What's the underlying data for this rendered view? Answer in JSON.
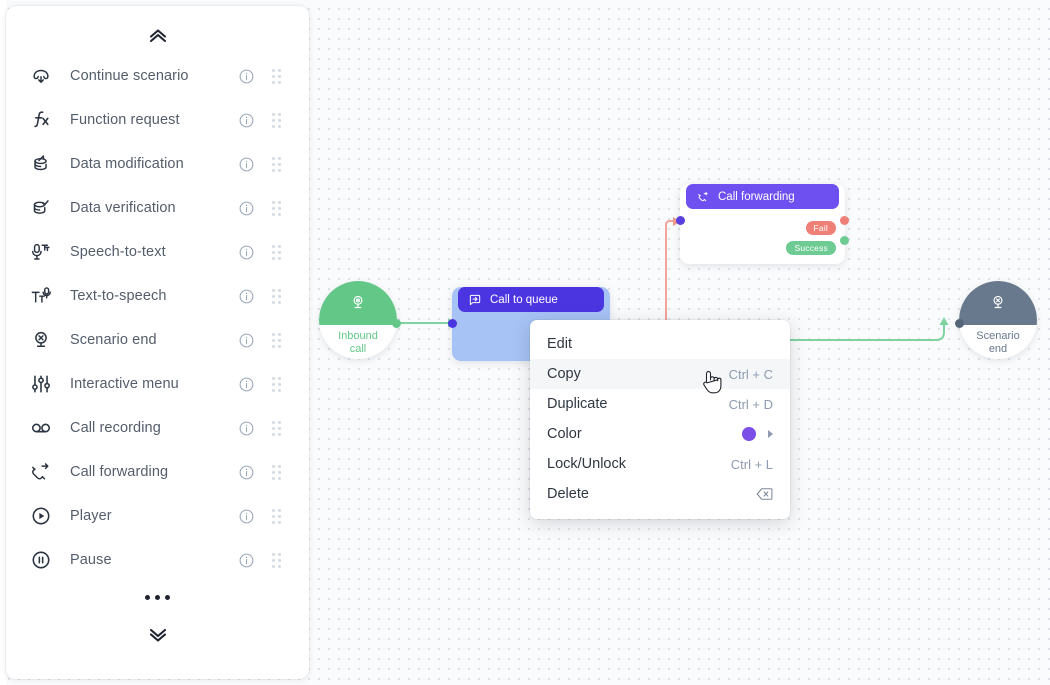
{
  "sidebar": {
    "collapse_up_icon": "double-chevron-up-icon",
    "collapse_down_icon": "double-chevron-down-icon",
    "more_icon": "ellipsis-icon",
    "items": [
      {
        "label": "Continue scenario",
        "icon": "continue-scenario-icon",
        "info_icon": "info-icon",
        "grip_icon": "drag-handle-icon"
      },
      {
        "label": "Function request",
        "icon": "function-request-icon",
        "info_icon": "info-icon",
        "grip_icon": "drag-handle-icon"
      },
      {
        "label": "Data modification",
        "icon": "data-modification-icon",
        "info_icon": "info-icon",
        "grip_icon": "drag-handle-icon"
      },
      {
        "label": "Data verification",
        "icon": "data-verification-icon",
        "info_icon": "info-icon",
        "grip_icon": "drag-handle-icon"
      },
      {
        "label": "Speech-to-text",
        "icon": "speech-to-text-icon",
        "info_icon": "info-icon",
        "grip_icon": "drag-handle-icon"
      },
      {
        "label": "Text-to-speech",
        "icon": "text-to-speech-icon",
        "info_icon": "info-icon",
        "grip_icon": "drag-handle-icon"
      },
      {
        "label": "Scenario end",
        "icon": "scenario-end-icon",
        "info_icon": "info-icon",
        "grip_icon": "drag-handle-icon"
      },
      {
        "label": "Interactive menu",
        "icon": "interactive-menu-icon",
        "info_icon": "info-icon",
        "grip_icon": "drag-handle-icon"
      },
      {
        "label": "Call recording",
        "icon": "call-recording-icon",
        "info_icon": "info-icon",
        "grip_icon": "drag-handle-icon"
      },
      {
        "label": "Call forwarding",
        "icon": "call-forwarding-icon",
        "info_icon": "info-icon",
        "grip_icon": "drag-handle-icon"
      },
      {
        "label": "Player",
        "icon": "player-icon",
        "info_icon": "info-icon",
        "grip_icon": "drag-handle-icon"
      },
      {
        "label": "Pause",
        "icon": "pause-icon",
        "info_icon": "info-icon",
        "grip_icon": "drag-handle-icon"
      }
    ]
  },
  "canvas": {
    "nodes": {
      "inbound_call": {
        "label_line1": "Inbound",
        "label_line2": "call",
        "icon": "inbound-call-icon",
        "color": "#63c787"
      },
      "call_to_queue": {
        "title": "Call to queue",
        "icon": "call-to-queue-icon",
        "header_color": "#4b35e0",
        "selected_color": "#a7c2f5",
        "selected": true
      },
      "call_forwarding": {
        "title": "Call forwarding",
        "icon": "call-forwarding-icon",
        "header_color": "#6e4ff0",
        "outputs": [
          {
            "label": "Fail",
            "color": "#ef8078"
          },
          {
            "label": "Success",
            "color": "#6ecb93"
          }
        ]
      },
      "scenario_end": {
        "label_line1": "Scenario",
        "label_line2": "end",
        "icon": "scenario-end-icon",
        "color": "#68798d"
      }
    },
    "edges": [
      {
        "from": "inbound_call",
        "to": "call_to_queue",
        "color": "#7fd3a0"
      },
      {
        "from": "below",
        "to": "call_forwarding",
        "color": "#f09a8e"
      },
      {
        "from": "call_forwarding_success",
        "to": "scenario_end",
        "color": "#7fd3a0"
      }
    ]
  },
  "context_menu": {
    "items": [
      {
        "label": "Edit",
        "accel": "",
        "active": false,
        "trailing": "none"
      },
      {
        "label": "Copy",
        "accel": "Ctrl + C",
        "active": true,
        "trailing": "none"
      },
      {
        "label": "Duplicate",
        "accel": "Ctrl + D",
        "active": false,
        "trailing": "none"
      },
      {
        "label": "Color",
        "accel": "",
        "active": false,
        "trailing": "color",
        "color": "#7b4fe8",
        "caret_icon": "chevron-right-icon"
      },
      {
        "label": "Lock/Unlock",
        "accel": "Ctrl + L",
        "active": false,
        "trailing": "none"
      },
      {
        "label": "Delete",
        "accel": "",
        "active": false,
        "trailing": "backspace",
        "icon": "backspace-icon"
      }
    ]
  },
  "cursor": {
    "icon": "hand-pointer-cursor"
  }
}
